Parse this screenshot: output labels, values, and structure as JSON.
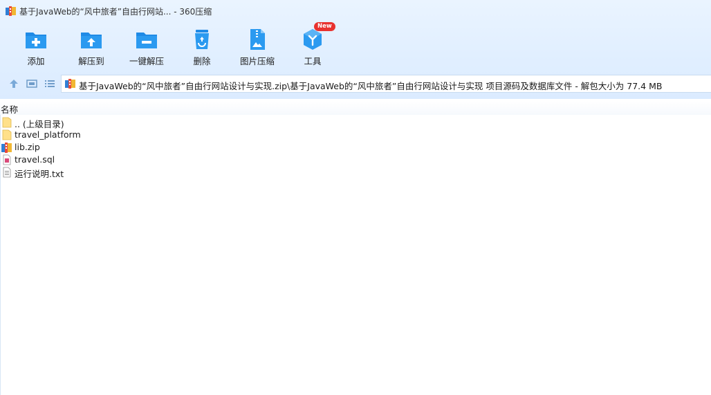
{
  "window": {
    "title": "基于JavaWeb的“风中旅者”自由行网站... - 360压缩"
  },
  "toolbar": {
    "items": [
      {
        "label": "添加",
        "icon": "add-folder-icon"
      },
      {
        "label": "解压到",
        "icon": "extract-to-icon"
      },
      {
        "label": "一键解压",
        "icon": "one-click-extract-icon"
      },
      {
        "label": "删除",
        "icon": "recycle-bin-icon"
      },
      {
        "label": "图片压缩",
        "icon": "image-compress-icon"
      },
      {
        "label": "工具",
        "icon": "tools-cube-icon"
      }
    ],
    "new_badge": "New"
  },
  "nav": {
    "path": "基于JavaWeb的“风中旅者”自由行网站设计与实现.zip\\基于JavaWeb的“风中旅者”自由行网站设计与实现 项目源码及数据库文件 - 解包大小为 77.4 MB"
  },
  "columns": {
    "name": "名称"
  },
  "files": [
    {
      "name": ".. (上级目录)",
      "type": "folder"
    },
    {
      "name": "travel_platform",
      "type": "folder"
    },
    {
      "name": "lib.zip",
      "type": "zip"
    },
    {
      "name": "travel.sql",
      "type": "sql"
    },
    {
      "name": "运行说明.txt",
      "type": "txt"
    }
  ],
  "colors": {
    "accent": "#1e88e5",
    "header_bg": "#e1efff",
    "badge": "#e8322f"
  }
}
